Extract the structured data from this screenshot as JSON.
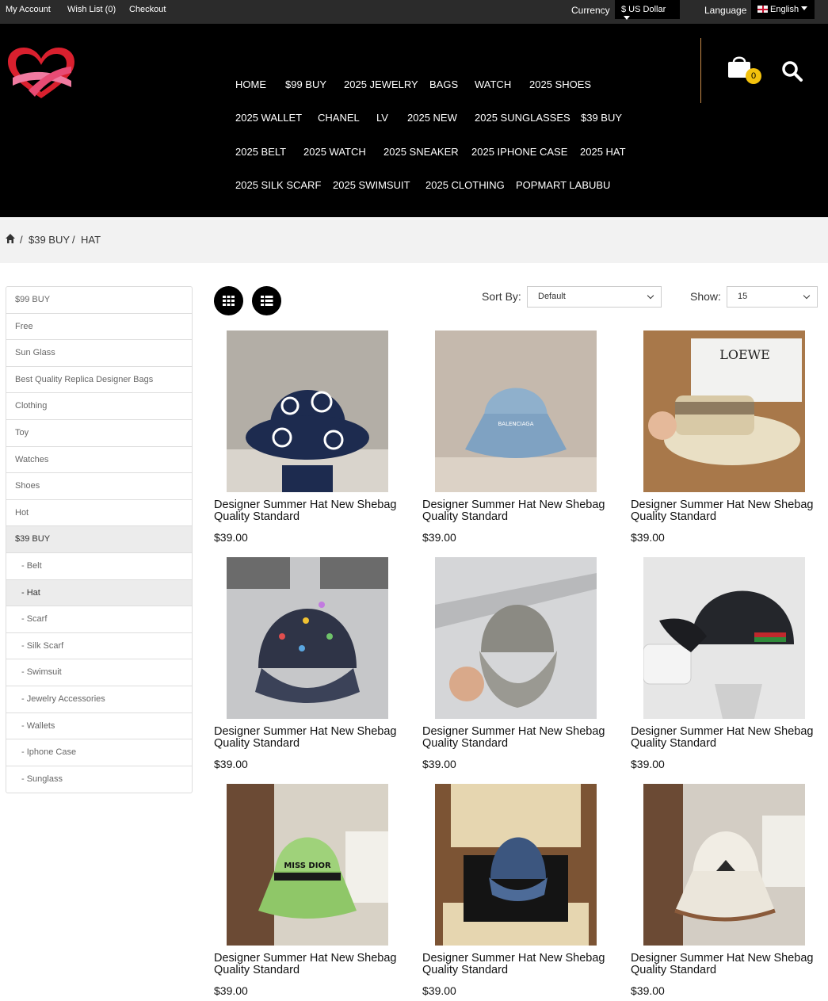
{
  "topbar": {
    "my_account": "My Account",
    "wish_list": "Wish List (0)",
    "checkout": "Checkout",
    "currency_label": "Currency",
    "currency_value": "$ US Dollar",
    "language_label": "Language",
    "language_value": "English"
  },
  "nav": {
    "items": [
      "HOME",
      "$99 BUY",
      "2025 JEWELRY",
      "BAGS",
      "WATCH",
      "2025 SHOES",
      "2025 WALLET",
      "CHANEL",
      "LV",
      "2025 NEW",
      "2025 SUNGLASSES",
      "$39 BUY",
      "2025 BELT",
      "2025 WATCH",
      "2025 SNEAKER",
      "2025 IPHONE CASE",
      "2025 HAT",
      "2025 SILK SCARF",
      "2025 SWIMSUIT",
      "2025 CLOTHING",
      "POPMART LABUBU"
    ],
    "cart_count": "0"
  },
  "breadcrumb": {
    "sep": "/",
    "level1": "$39 BUY",
    "level2": "HAT"
  },
  "sidebar": {
    "items": [
      "$99 BUY",
      "Free",
      "Sun Glass",
      "Best Quality Replica Designer Bags",
      "Clothing",
      "Toy",
      "Watches",
      "Shoes",
      "Hot",
      "$39 BUY",
      "- Belt",
      "- Hat",
      "- Scarf",
      "- Silk Scarf",
      "- Swimsuit",
      "- Jewelry Accessories",
      "- Wallets",
      "- Iphone Case",
      "- Sunglass"
    ]
  },
  "toolbar": {
    "sort_label": "Sort By:",
    "sort_value": "Default",
    "show_label": "Show:",
    "show_value": "15"
  },
  "products": [
    {
      "name_line1": "Designer Summer Hat New Shebag",
      "name_line2": "Quality Standard",
      "price": "$39.00"
    },
    {
      "name_line1": "Designer Summer Hat New Shebag",
      "name_line2": "Quality Standard",
      "price": "$39.00"
    },
    {
      "name_line1": "Designer Summer Hat New Shebag",
      "name_line2": "Quality Standard",
      "price": "$39.00"
    },
    {
      "name_line1": "Designer Summer Hat New Shebag",
      "name_line2": "Quality Standard",
      "price": "$39.00"
    },
    {
      "name_line1": "Designer Summer Hat New Shebag",
      "name_line2": "Quality Standard",
      "price": "$39.00"
    },
    {
      "name_line1": "Designer Summer Hat New Shebag",
      "name_line2": "Quality Standard",
      "price": "$39.00"
    },
    {
      "name_line1": "Designer Summer Hat New Shebag",
      "name_line2": "Quality Standard",
      "price": "$39.00"
    },
    {
      "name_line1": "Designer Summer Hat New Shebag",
      "name_line2": "Quality Standard",
      "price": "$39.00"
    },
    {
      "name_line1": "Designer Summer Hat New Shebag",
      "name_line2": "Quality Standard",
      "price": "$39.00"
    }
  ],
  "product_images": {
    "items": [
      {
        "brand_text": "",
        "color": "#1d2b4f"
      },
      {
        "brand_text": "BALENCIAGA",
        "color": "#8fb0cc"
      },
      {
        "brand_text": "LOEWE",
        "color": "#e9dfc4"
      },
      {
        "brand_text": "",
        "color": "#2f3447"
      },
      {
        "brand_text": "",
        "color": "#8b8a83"
      },
      {
        "brand_text": "",
        "color": "#24262b"
      },
      {
        "brand_text": "MISS DIOR",
        "color": "#9fd27a"
      },
      {
        "brand_text": "",
        "color": "#3c567f"
      },
      {
        "brand_text": "",
        "color": "#f1ede4"
      }
    ]
  },
  "colors": {
    "topbar_bg": "#2b2b2b",
    "header_bg": "#000000",
    "accent": "#f4c20d",
    "divider": "#c98c4a"
  }
}
